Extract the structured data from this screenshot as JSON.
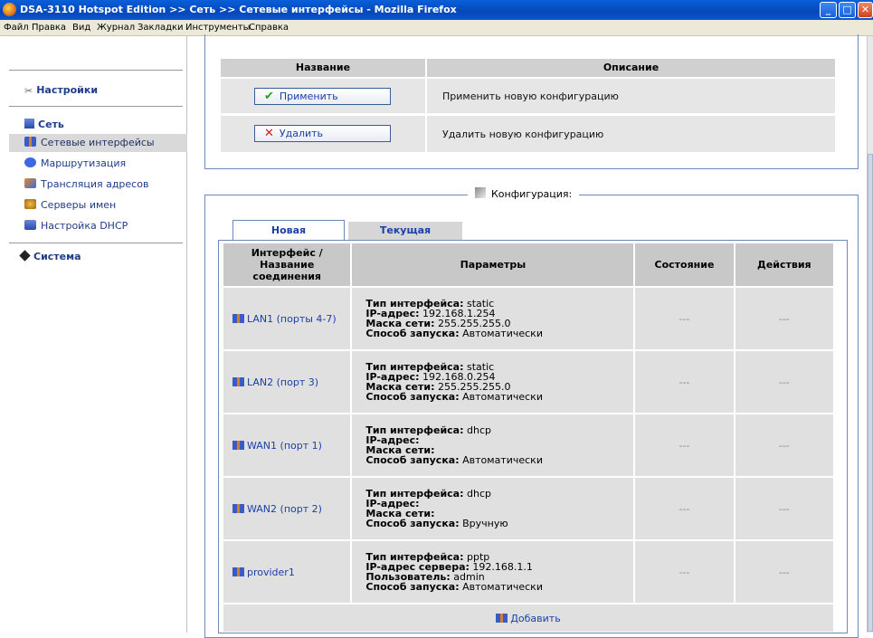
{
  "window": {
    "title": "DSA-3110 Hotspot Edition >> Сеть >> Сетевые интерфейсы - Mozilla Firefox"
  },
  "menu": [
    "Файл",
    "Правка",
    "Вид",
    "Журнал",
    "Закладки",
    "Инструменты",
    "Справка"
  ],
  "sidebar": {
    "settings": "Настройки",
    "network": "Сеть",
    "items": [
      "Сетевые интерфейсы",
      "Маршрутизация",
      "Трансляция адресов",
      "Серверы имен",
      "Настройка DHCP"
    ],
    "system": "Система"
  },
  "actions": {
    "col_name": "Название",
    "col_desc": "Описание",
    "apply_label": "Применить",
    "apply_desc": "Применить новую конфигурацию",
    "delete_label": "Удалить",
    "delete_desc": "Удалить новую конфигурацию"
  },
  "config": {
    "legend": "Конфигурация:",
    "tabs": [
      "Новая",
      "Текущая"
    ],
    "headers": [
      "Интерфейс / Название соединения",
      "Параметры",
      "Состояние",
      "Действия"
    ],
    "rows": [
      {
        "name": "LAN1 (порты 4-7)",
        "params": [
          [
            "Тип интерфейса:",
            "static"
          ],
          [
            "IP-адрес:",
            "192.168.1.254"
          ],
          [
            "Маска сети:",
            "255.255.255.0"
          ],
          [
            "Способ запуска:",
            "Автоматически"
          ]
        ],
        "state": "---",
        "actions": "---"
      },
      {
        "name": "LAN2 (порт 3)",
        "params": [
          [
            "Тип интерфейса:",
            "static"
          ],
          [
            "IP-адрес:",
            "192.168.0.254"
          ],
          [
            "Маска сети:",
            "255.255.255.0"
          ],
          [
            "Способ запуска:",
            "Автоматически"
          ]
        ],
        "state": "---",
        "actions": "---"
      },
      {
        "name": "WAN1 (порт 1)",
        "params": [
          [
            "Тип интерфейса:",
            "dhcp"
          ],
          [
            "IP-адрес:",
            ""
          ],
          [
            "Маска сети:",
            ""
          ],
          [
            "Способ запуска:",
            "Автоматически"
          ]
        ],
        "state": "---",
        "actions": "---"
      },
      {
        "name": "WAN2 (порт 2)",
        "params": [
          [
            "Тип интерфейса:",
            "dhcp"
          ],
          [
            "IP-адрес:",
            ""
          ],
          [
            "Маска сети:",
            ""
          ],
          [
            "Способ запуска:",
            "Вручную"
          ]
        ],
        "state": "---",
        "actions": "---"
      },
      {
        "name": "provider1",
        "params": [
          [
            "Тип интерфейса:",
            "pptp"
          ],
          [
            "IP-адрес сервера:",
            "192.168.1.1"
          ],
          [
            "Пользователь:",
            "admin"
          ],
          [
            "Способ запуска:",
            "Автоматически"
          ]
        ],
        "state": "---",
        "actions": "---"
      }
    ],
    "add_label": "Добавить"
  }
}
